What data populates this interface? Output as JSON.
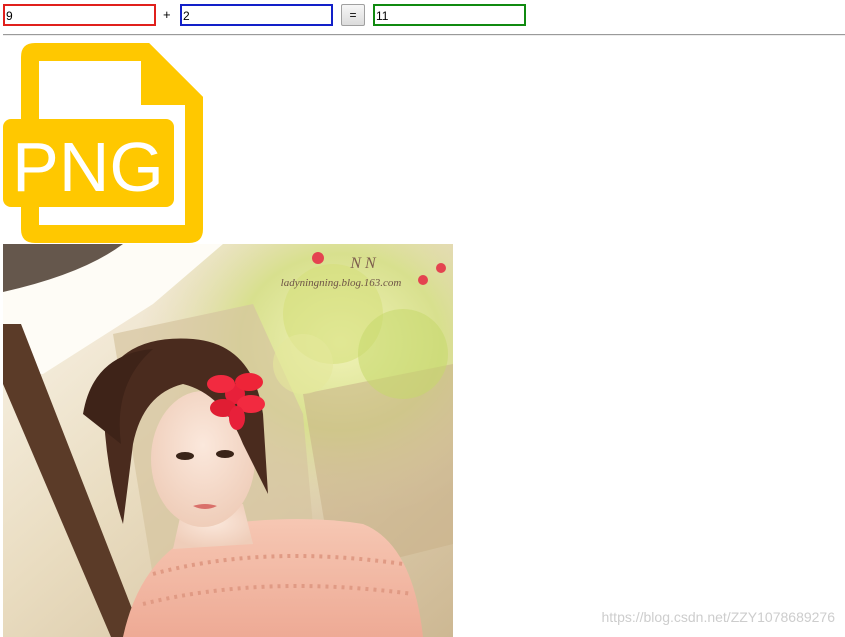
{
  "calculator": {
    "operand_a": "9",
    "operator": "+",
    "operand_b": "2",
    "equals_label": "=",
    "result": "11",
    "colors": {
      "operand_a_border": "#e0201c",
      "operand_b_border": "#1220c8",
      "result_border": "#108a10"
    }
  },
  "file_icon": {
    "icon": "png-file-icon",
    "label": "PNG",
    "color": "#ffc800"
  },
  "photo": {
    "caption": "ladyningning.blog.163.com",
    "monogram": "N N"
  },
  "watermark": {
    "text": "https://blog.csdn.net/ZZY1078689276"
  }
}
